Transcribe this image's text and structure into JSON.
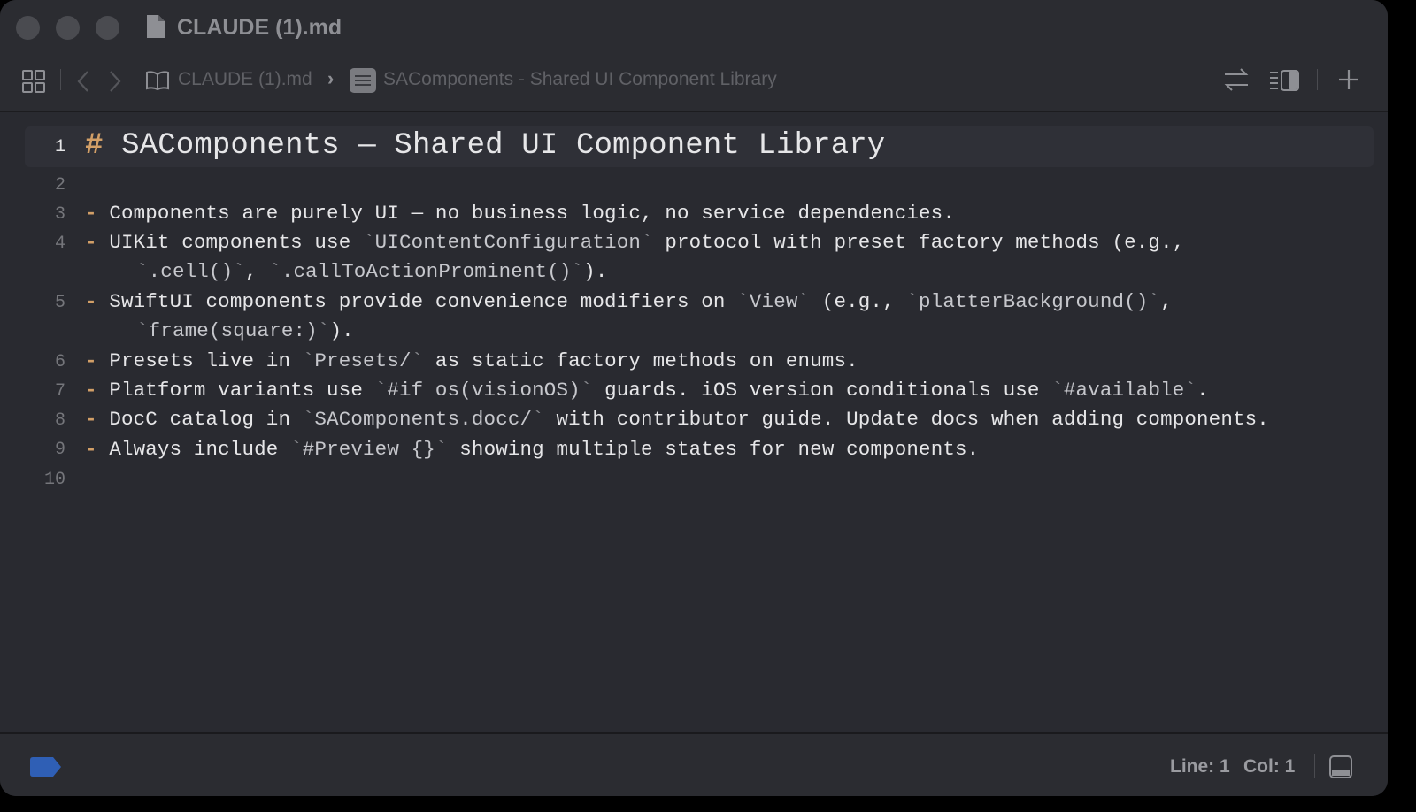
{
  "window": {
    "title": "CLAUDE (1).md"
  },
  "toolbar": {
    "breadcrumb_file": "CLAUDE (1).md",
    "breadcrumb_symbol": "SAComponents - Shared UI Component Library",
    "icons": [
      "grid-icon",
      "back-icon",
      "forward-icon",
      "book-icon",
      "symbol-icon",
      "swap-icon",
      "inspector-toggle-icon",
      "add-icon"
    ]
  },
  "editor": {
    "active_line": 1,
    "lines": [
      {
        "num": "1",
        "text": "# SAComponents — Shared UI Component Library"
      },
      {
        "num": "2",
        "text": ""
      },
      {
        "num": "3",
        "text": "- Components are purely UI — no business logic, no service dependencies."
      },
      {
        "num": "4",
        "text": "- UIKit components use `UIContentConfiguration` protocol with preset factory methods (e.g.,",
        "cont": "`.cell()`, `.callToActionProminent()`)."
      },
      {
        "num": "5",
        "text": "- SwiftUI components provide convenience modifiers on `View` (e.g., `platterBackground()`,",
        "cont": "`frame(square:)`)."
      },
      {
        "num": "6",
        "text": "- Presets live in `Presets/` as static factory methods on enums."
      },
      {
        "num": "7",
        "text": "- Platform variants use `#if os(visionOS)` guards. iOS version conditionals use `#available`."
      },
      {
        "num": "8",
        "text": "- DocC catalog in `SAComponents.docc/` with contributor guide. Update docs when adding components."
      },
      {
        "num": "9",
        "text": "- Always include `#Preview {}` showing multiple states for new components."
      },
      {
        "num": "10",
        "text": ""
      }
    ]
  },
  "statusbar": {
    "line_label": "Line: 1",
    "col_label": "Col: 1"
  },
  "colors": {
    "background": "#292a30",
    "markdown_marker": "#d29f67",
    "text": "#e6e6e8",
    "tag_blue": "#2f5fb5"
  }
}
